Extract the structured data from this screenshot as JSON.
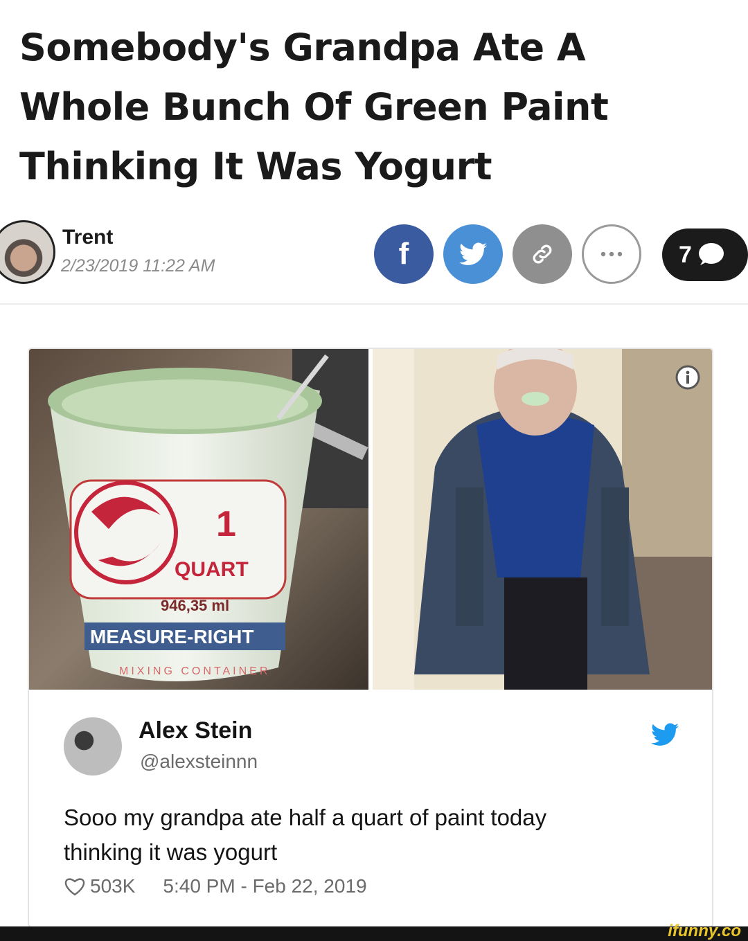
{
  "article": {
    "headline": "Somebody's Grandpa Ate A Whole Bunch Of Green Paint Thinking It Was Yogurt",
    "author": "Trent",
    "date": "2/23/2019 11:22 AM"
  },
  "share": {
    "facebook_glyph": "f",
    "comment_count": "7",
    "icons": [
      "facebook-icon",
      "twitter-icon",
      "link-icon",
      "more-icon",
      "comment-icon"
    ]
  },
  "tweet": {
    "name": "Alex Stein",
    "handle": "@alexsteinnn",
    "text_line1": "Sooo my grandpa ate half a quart of paint today",
    "text_line2": "thinking it was yogurt",
    "likes": "503K",
    "timestamp": "5:40 PM - Feb 22, 2019"
  },
  "cup_label": {
    "number": "1",
    "unit": "QUART",
    "volume": "946,35 ml",
    "brand": "MEASURE-RIGHT",
    "subtext": "MIXING CONTAINER"
  },
  "watermark": "ifunny.co",
  "colors": {
    "facebook": "#3b5ba0",
    "twitter": "#4a90d6",
    "link": "#8f8f8f",
    "comments_bg": "#1b1b1b",
    "watermark": "#e8c52a"
  }
}
